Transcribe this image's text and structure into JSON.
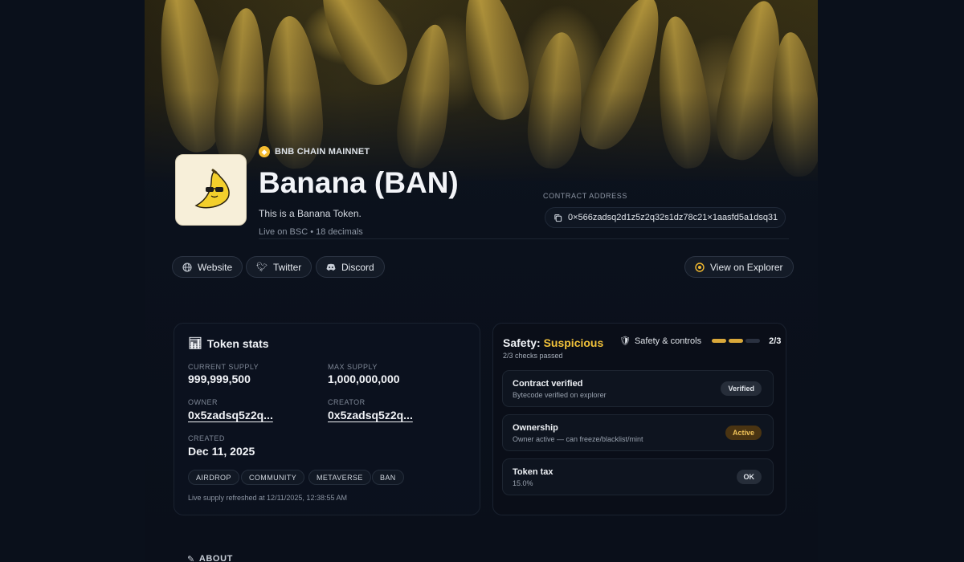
{
  "token": {
    "chain": "BNB CHAIN MAINNET",
    "title": "Banana (BAN)",
    "description": "This is a Banana Token.",
    "meta": "Live on BSC • 18 decimals"
  },
  "contract": {
    "label": "CONTRACT ADDRESS",
    "address": "0×566zadsq2d1z5z2q32s1dz78c21×1aasfd5a1dsq31"
  },
  "links": {
    "website": "Website",
    "twitter": "Twitter",
    "discord": "Discord",
    "explorer": "View on Explorer"
  },
  "stats": {
    "title": "Token stats",
    "current_supply_label": "CURRENT SUPPLY",
    "current_supply": "999,999,500",
    "max_supply_label": "MAX SUPPLY",
    "max_supply": "1,000,000,000",
    "owner_label": "OWNER",
    "owner": "0x5zadsq5z2q...",
    "creator_label": "CREATOR",
    "creator": "0x5zadsq5z2q...",
    "created_label": "CREATED",
    "created": "Dec 11, 2025",
    "tags": [
      "AIRDROP",
      "COMMUNITY",
      "METAVERSE",
      "BAN"
    ],
    "refreshed": "Live supply refreshed at 12/11/2025, 12:38:55 AM"
  },
  "safety": {
    "label": "Safety:",
    "status": "Suspicious",
    "checks_passed": "2/3 checks passed",
    "controls_label": "Safety & controls",
    "ratio": "2/3",
    "progress_fraction": 0.667,
    "status_color": "#f2c23a",
    "checks": [
      {
        "title": "Contract verified",
        "subtitle": "Bytecode verified on explorer",
        "badge": "Verified"
      },
      {
        "title": "Ownership",
        "subtitle": "Owner active — can freeze/blacklist/mint",
        "badge": "Active"
      },
      {
        "title": "Token tax",
        "subtitle": "15.0%",
        "badge": "OK"
      }
    ]
  },
  "about": {
    "title": "ABOUT"
  }
}
